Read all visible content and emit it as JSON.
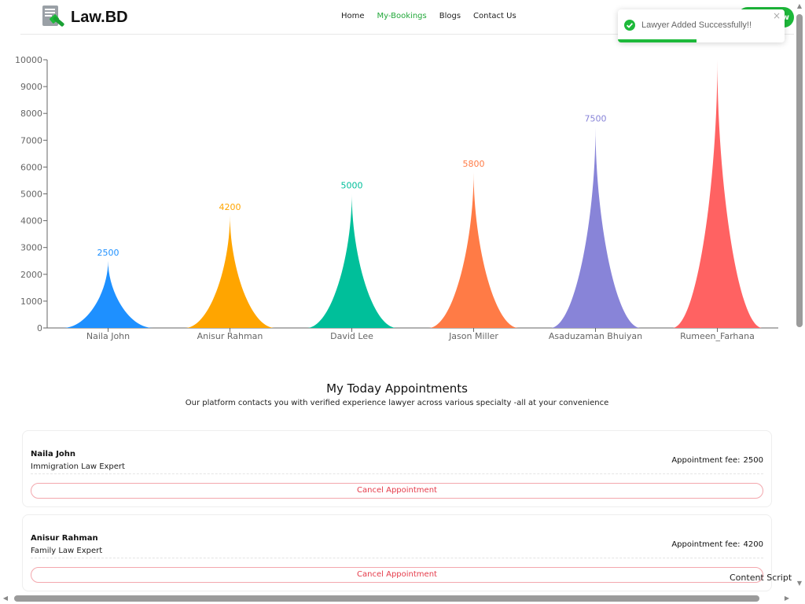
{
  "brand": {
    "name": "Law.BD",
    "logo_icon": "gavel-document-icon"
  },
  "nav": {
    "items": [
      {
        "label": "Home",
        "active": false
      },
      {
        "label": "My-Bookings",
        "active": true
      },
      {
        "label": "Blogs",
        "active": false
      },
      {
        "label": "Contact Us",
        "active": false
      }
    ],
    "pill_label": "w"
  },
  "toast": {
    "message": "Lawyer Added Successfully!!",
    "icon": "check-circle-icon",
    "close": "×",
    "progress": 0.47,
    "color": "#1db93a"
  },
  "chart_data": {
    "type": "bar",
    "categories": [
      "Naila John",
      "Anisur Rahman",
      "David Lee",
      "Jason Miller",
      "Asaduzaman Bhuiyan",
      "Rumeen_Farhana"
    ],
    "values": [
      2500,
      4200,
      5000,
      5800,
      7500,
      10000
    ],
    "data_labels": [
      "2500",
      "4200",
      "5000",
      "5800",
      "7500",
      ""
    ],
    "colors": [
      "#1e90ff",
      "#ffa500",
      "#00bf9a",
      "#ff7b46",
      "#8884d8",
      "#ff6262"
    ],
    "yticks": [
      "0",
      "1000",
      "2000",
      "3000",
      "4000",
      "5000",
      "6000",
      "7000",
      "8000",
      "9000",
      "10000"
    ],
    "ylim": [
      0,
      10000
    ],
    "shape": "triangle-spike",
    "grid": false
  },
  "appointments": {
    "title": "My Today Appointments",
    "subtitle": "Our platform contacts you with verified experience lawyer across various specialty -all at your convenience",
    "fee_label": "Appointment fee:",
    "cancel_label": "Cancel Appointment",
    "items": [
      {
        "name": "Naila John",
        "specialty": "Immigration Law Expert",
        "fee": "2500"
      },
      {
        "name": "Anisur Rahman",
        "specialty": "Family Law Expert",
        "fee": "4200"
      }
    ]
  },
  "overlay": {
    "content_script": "Content Script"
  }
}
